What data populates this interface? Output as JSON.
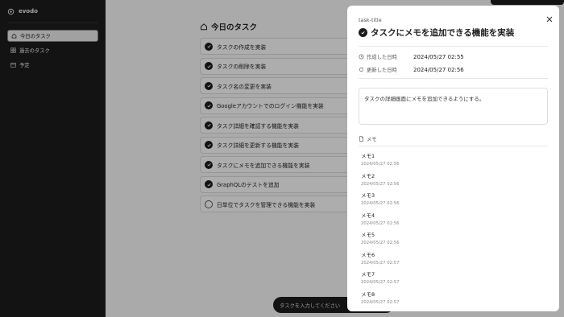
{
  "app": {
    "name": "evodo"
  },
  "sidebar": {
    "items": [
      {
        "label": "今日のタスク",
        "icon": "home-icon",
        "active": true
      },
      {
        "label": "過去のタスク",
        "icon": "grid-icon",
        "active": false
      },
      {
        "label": "予定",
        "icon": "calendar-icon",
        "active": false
      }
    ]
  },
  "main": {
    "title": "今日のタスク",
    "tasks": [
      {
        "label": "タスクの作成を実装",
        "done": true
      },
      {
        "label": "タスクの削除を実装",
        "done": true
      },
      {
        "label": "タスク名の変更を実装",
        "done": true
      },
      {
        "label": "Googleアカウントでのログイン機能を実装",
        "done": true
      },
      {
        "label": "タスク詳細を確認する機能を実装",
        "done": true
      },
      {
        "label": "タスク詳細を更新する機能を実装",
        "done": true
      },
      {
        "label": "タスクにメモを追加できる機能を実装",
        "done": true
      },
      {
        "label": "GraphQLのテストを追加",
        "done": true
      },
      {
        "label": "日単位でタスクを管理できる機能を実装",
        "done": false
      }
    ],
    "input_placeholder": "タスクを入力してください"
  },
  "drawer": {
    "label": "task-title",
    "title": "タスクにメモを追加できる機能を実装",
    "created_label": "作成した日時",
    "created_value": "2024/05/27  02:55",
    "updated_label": "更新した日時",
    "updated_value": "2024/05/27  02:56",
    "description": "タスクの詳細画面にメモを追加できるようにする。",
    "memo_section_label": "メモ",
    "memos": [
      {
        "title": "メモ1",
        "time": "2024/05/27  02:56"
      },
      {
        "title": "メモ2",
        "time": "2024/05/27  02:56"
      },
      {
        "title": "メモ3",
        "time": "2024/05/27  02:56"
      },
      {
        "title": "メモ4",
        "time": "2024/05/27  02:56"
      },
      {
        "title": "メモ5",
        "time": "2024/05/27  02:56"
      },
      {
        "title": "メモ6",
        "time": "2024/05/27  02:57"
      },
      {
        "title": "メモ7",
        "time": "2024/05/27  02:57"
      },
      {
        "title": "メモ8",
        "time": "2024/05/27  02:57"
      }
    ]
  }
}
